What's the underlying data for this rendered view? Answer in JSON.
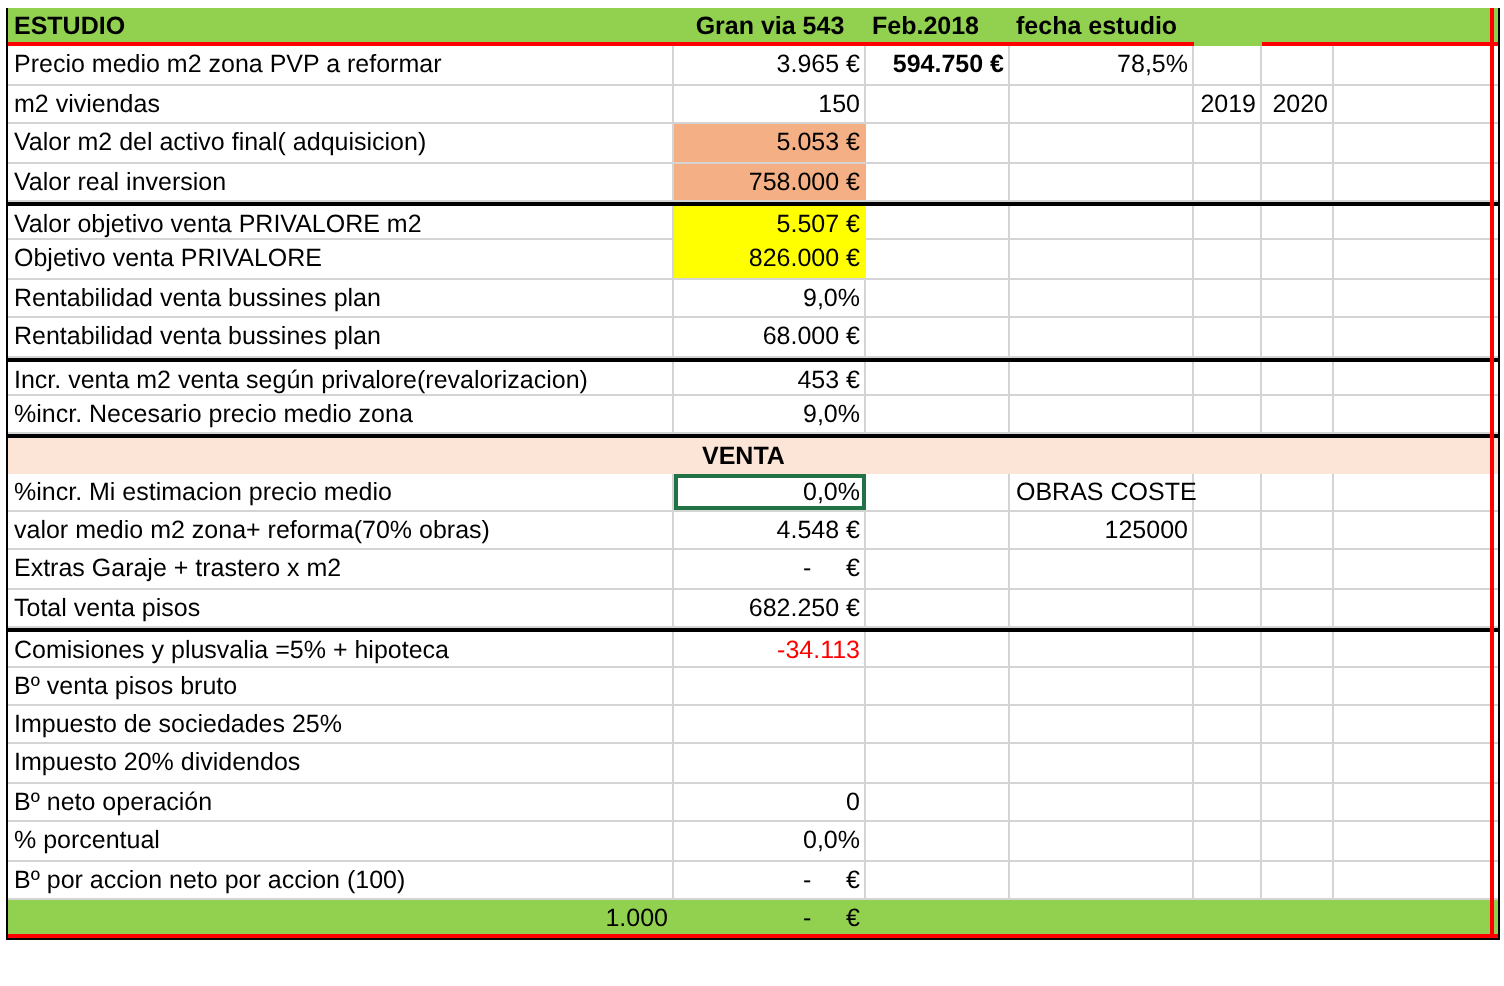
{
  "header": {
    "label": "ESTUDIO",
    "value": "Gran via 543",
    "column_3": "Feb.2018",
    "column_4": "fecha estudio"
  },
  "rows": [
    {
      "label": "Precio medio m2 zona PVP a reformar",
      "group_start": false,
      "value": {
        "text": "3.965 €",
        "selected": false
      },
      "column_3": {
        "text": "594.750 €",
        "kind": "bold"
      },
      "column_4": {
        "text": "78,5%"
      }
    },
    {
      "label": "m2 viviendas",
      "group_start": false,
      "value": {
        "text": "150",
        "selected": false
      },
      "column_5": "2019",
      "column_6": "2020"
    },
    {
      "label": "Valor m2 del activo final( adquisicion)",
      "group_start": false,
      "value": {
        "text": "5.053 €",
        "selected": false,
        "color": "#f4b084"
      }
    },
    {
      "label": "Valor real inversion",
      "group_start": false,
      "value": {
        "text": "758.000 €",
        "selected": false,
        "color": "#f4b084"
      }
    },
    {
      "label": "Valor objetivo venta PRIVALORE m2",
      "group_start": true,
      "value": {
        "text": "5.507 €",
        "selected": false,
        "color": "#ffff00"
      }
    },
    {
      "label": "Objetivo venta PRIVALORE",
      "group_start": false,
      "value": {
        "text": "826.000 €",
        "selected": false,
        "color": "#ffff00"
      }
    },
    {
      "label": "Rentabilidad venta bussines plan",
      "group_start": false,
      "value": {
        "text": "9,0%",
        "selected": false
      }
    },
    {
      "label": "Rentabilidad venta bussines plan",
      "group_start": false,
      "value": {
        "text": "68.000 €",
        "selected": false
      }
    },
    {
      "label": "Incr. venta m2 venta según privalore(revalorizacion)",
      "group_start": true,
      "value": {
        "text": "453 €",
        "selected": false
      }
    },
    {
      "label": "%incr. Necesario precio medio zona",
      "group_start": false,
      "value": {
        "text": "9,0%",
        "selected": false
      }
    }
  ],
  "section": {
    "title": "VENTA"
  },
  "sale_rows": [
    {
      "label": "%incr. Mi estimacion precio medio",
      "group_start": false,
      "value": {
        "text": "0,0%",
        "selected": true
      },
      "column_4": {
        "text": "OBRAS COSTE"
      }
    },
    {
      "label": "valor medio m2 zona+ reforma(70% obras)",
      "group_start": false,
      "value": {
        "text": "4.548 €",
        "selected": false
      },
      "column_4": {
        "text": "125000"
      }
    },
    {
      "label": "Extras Garaje + trastero x m2",
      "group_start": false,
      "value": {
        "text": "-     €",
        "selected": false
      }
    },
    {
      "label": "Total venta pisos",
      "group_start": false,
      "value": {
        "text": "682.250 €",
        "selected": false
      }
    },
    {
      "label": "Comisiones y plusvalia =5% + hipoteca",
      "group_start": true,
      "value": {
        "text": "-34.113",
        "selected": false,
        "kind": "negative"
      }
    },
    {
      "label": "Bº venta pisos bruto",
      "group_start": false
    },
    {
      "label": "Impuesto de sociedades 25%",
      "group_start": false
    },
    {
      "label": "Impuesto 20% dividendos",
      "group_start": false
    },
    {
      "label": "Bº neto operación",
      "group_start": false,
      "value": {
        "text": "0",
        "selected": false
      }
    },
    {
      "label": "% porcentual",
      "group_start": false,
      "value": {
        "text": "0,0%",
        "selected": false
      }
    },
    {
      "label": "Bº por accion neto por accion (100)",
      "group_start": false,
      "value": {
        "text": "-     €",
        "selected": false
      }
    }
  ],
  "footer": {
    "column_1": "1.000",
    "value": "-     €"
  }
}
